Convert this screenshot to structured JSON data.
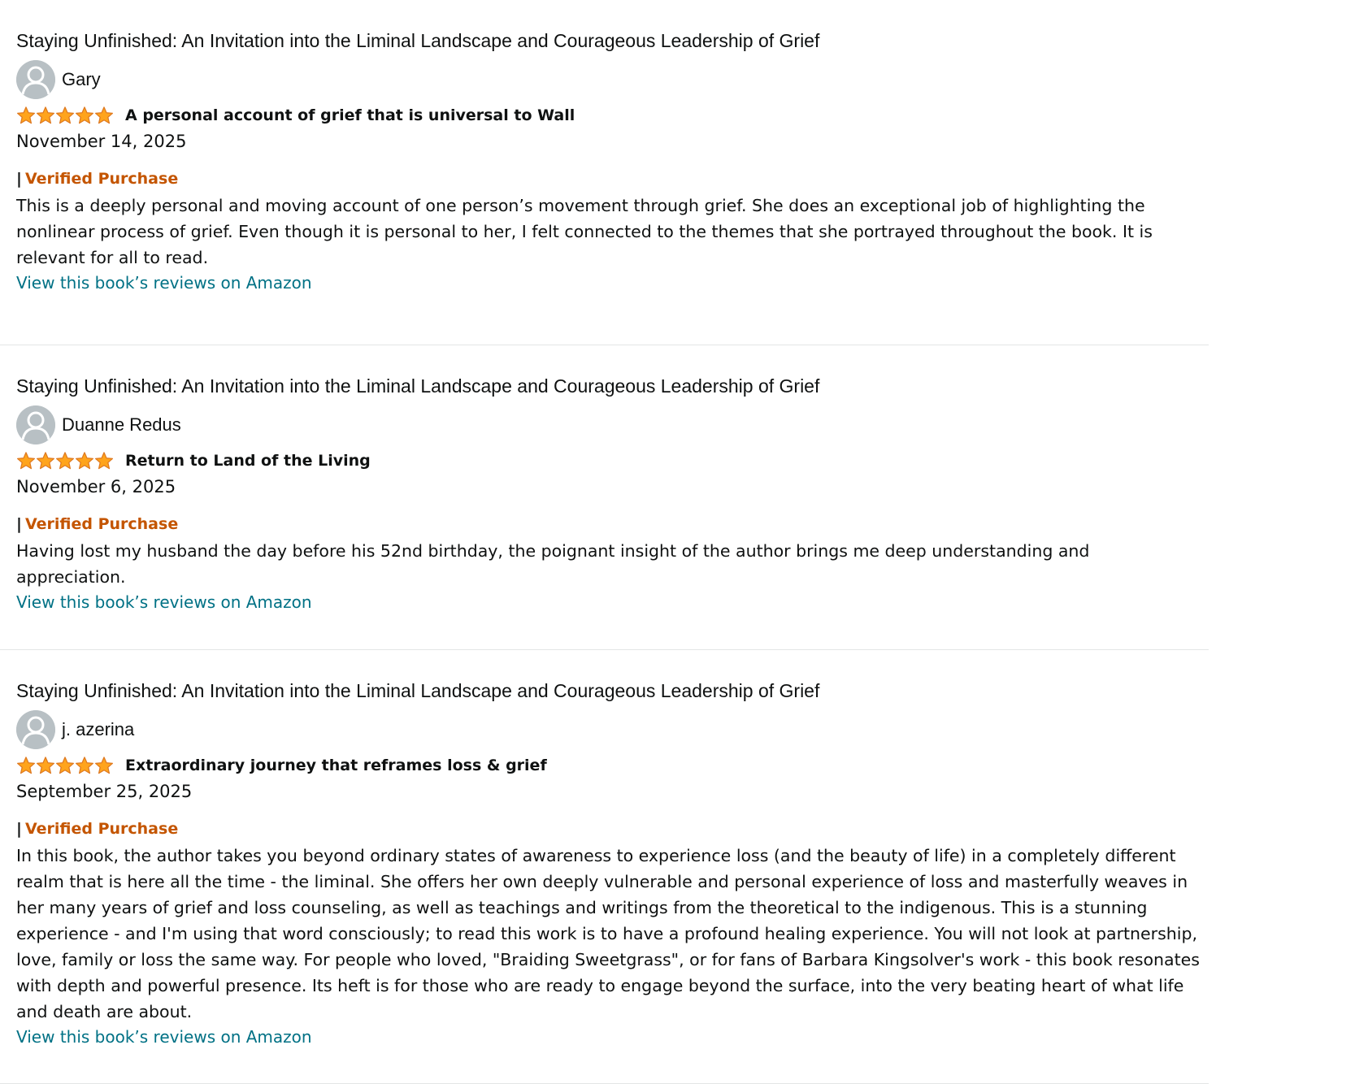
{
  "reviews": [
    {
      "book_title": "Staying Unfinished: An Invitation into the Liminal Landscape and Courageous Leadership of Grief",
      "reviewer": "Gary",
      "rating": 5,
      "headline": "A personal account of grief that is universal to Wall",
      "date": "November 14, 2025",
      "separator": "|",
      "verified_label": "Verified Purchase",
      "body": "This is a deeply personal and moving account of one person’s movement through grief. She does an exceptional job of highlighting the nonlinear process of grief. Even though it is personal to her, I felt connected to the themes that she portrayed throughout the book. It is relevant for all to read.",
      "link_text": "View this book’s reviews on Amazon"
    },
    {
      "book_title": "Staying Unfinished: An Invitation into the Liminal Landscape and Courageous Leadership of Grief",
      "reviewer": "Duanne Redus",
      "rating": 5,
      "headline": "Return to Land of the Living",
      "date": "November 6, 2025",
      "separator": "|",
      "verified_label": "Verified Purchase",
      "body": "Having lost my husband the day before his 52nd birthday, the poignant insight of the author brings me deep understanding and appreciation.",
      "link_text": "View this book’s reviews on Amazon"
    },
    {
      "book_title": "Staying Unfinished: An Invitation into the Liminal Landscape and Courageous Leadership of Grief",
      "reviewer": "j. azerina",
      "rating": 5,
      "headline": "Extraordinary journey that reframes loss & grief",
      "date": "September 25, 2025",
      "separator": "|",
      "verified_label": "Verified Purchase",
      "body": "In this book, the author takes you beyond ordinary states of awareness to experience loss (and the beauty of life) in a completely different realm that is here all the time - the liminal. She offers her own deeply vulnerable and personal experience of loss and masterfully weaves in her many years of grief and loss counseling, as well as teachings and writings from the theoretical to the indigenous. This is a stunning experience - and I'm using that word consciously; to read this work is to have a profound healing experience. You will not look at partnership, love, family or loss the same way. For people who loved, \"Braiding Sweetgrass\", or for fans of Barbara Kingsolver's work - this book resonates with depth and powerful presence. Its heft is for those who are ready to engage beyond the surface, into the very beating heart of what life and death are about.",
      "link_text": "View this book’s reviews on Amazon"
    }
  ],
  "colors": {
    "star_fill": "#ffa41c",
    "star_stroke": "#de7921",
    "verified": "#c45500",
    "link": "#007185",
    "avatar_bg": "#b8c0c4"
  },
  "icons": {
    "avatar": "user-avatar-icon",
    "star": "star-icon"
  }
}
